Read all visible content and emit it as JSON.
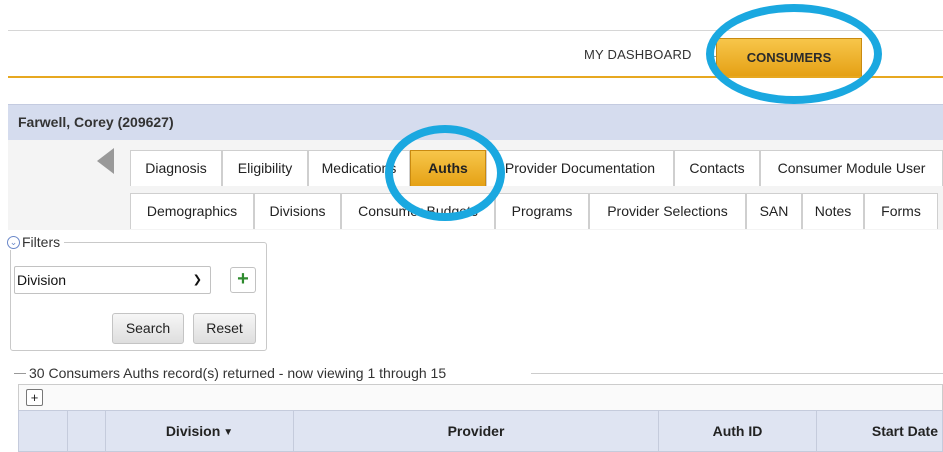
{
  "nav": {
    "dashboard_label": "MY DASHBOARD",
    "consumers_label": "CONSUMERS"
  },
  "consumer": {
    "name": "Farwell, Corey (209627)"
  },
  "tabs": {
    "row1": [
      {
        "label": "Diagnosis"
      },
      {
        "label": "Eligibility"
      },
      {
        "label": "Medications"
      },
      {
        "label": "Auths",
        "active": true
      },
      {
        "label": "Provider Documentation"
      },
      {
        "label": "Contacts"
      },
      {
        "label": "Consumer Module User"
      }
    ],
    "row2": [
      {
        "label": "Demographics"
      },
      {
        "label": "Divisions"
      },
      {
        "label": "Consumer Budgets"
      },
      {
        "label": "Programs"
      },
      {
        "label": "Provider Selections"
      },
      {
        "label": "SAN"
      },
      {
        "label": "Notes"
      },
      {
        "label": "Forms"
      }
    ]
  },
  "filters": {
    "legend": "Filters",
    "selected_field": "Division",
    "search_label": "Search",
    "reset_label": "Reset"
  },
  "grid": {
    "records_summary": "30 Consumers Auths record(s) returned - now viewing 1 through 15",
    "add_label": "+",
    "columns": [
      "Division",
      "Provider",
      "Auth ID",
      "Start Date"
    ]
  },
  "colors": {
    "accent": "#e5a115",
    "highlight": "#1aa8e0",
    "header_bg": "#dfe4f2"
  }
}
